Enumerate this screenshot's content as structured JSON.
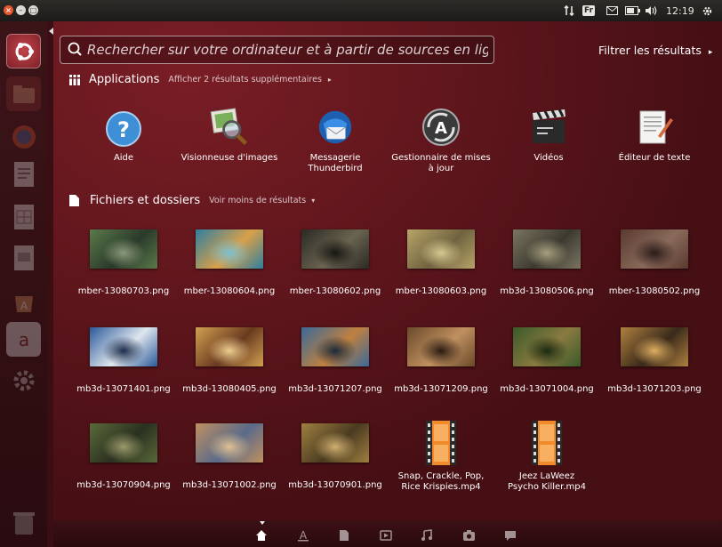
{
  "top_panel": {
    "window_close": "×",
    "keyboard_layout": "Fr",
    "clock": "12:19",
    "win_min": "–",
    "win_max": "□"
  },
  "search": {
    "placeholder": "Rechercher sur votre ordinateur et à partir de sources en ligne",
    "value": ""
  },
  "filter": {
    "label": "Filtrer les résultats"
  },
  "applications": {
    "title": "Applications",
    "more": "Afficher 2 résultats supplémentaires",
    "items": [
      {
        "label": "Aide",
        "icon": "help-icon"
      },
      {
        "label": "Visionneuse d'images",
        "icon": "image-viewer-icon"
      },
      {
        "label": "Messagerie Thunderbird",
        "icon": "thunderbird-icon"
      },
      {
        "label": "Gestionnaire de mises à jour",
        "icon": "update-manager-icon"
      },
      {
        "label": "Vidéos",
        "icon": "videos-icon"
      },
      {
        "label": "Éditeur de texte",
        "icon": "text-editor-icon"
      }
    ]
  },
  "files": {
    "title": "Fichiers et dossiers",
    "more": "Voir moins de résultats",
    "items": [
      {
        "label": "mber-13080703.png",
        "colors": [
          "#5a7a4a",
          "#2a3a2a",
          "#8a9a7a"
        ]
      },
      {
        "label": "mber-13080604.png",
        "colors": [
          "#2f7f9f",
          "#d9a04a",
          "#7ac0d0"
        ]
      },
      {
        "label": "mber-13080602.png",
        "colors": [
          "#2a2a24",
          "#6a6450",
          "#151512"
        ]
      },
      {
        "label": "mber-13080603.png",
        "colors": [
          "#b8a368",
          "#6f6340",
          "#d8c890"
        ]
      },
      {
        "label": "mb3d-13080506.png",
        "colors": [
          "#7a7460",
          "#3c3a30",
          "#a8a080"
        ]
      },
      {
        "label": "mber-13080502.png",
        "colors": [
          "#5a3a30",
          "#8a6a5a",
          "#2a1a18"
        ]
      },
      {
        "label": "mb3d-13071401.png",
        "colors": [
          "#2a5a9a",
          "#dfe6ee",
          "#1a2a4a"
        ]
      },
      {
        "label": "mb3d-13080405.png",
        "colors": [
          "#d0a050",
          "#6a3a20",
          "#f0d090"
        ]
      },
      {
        "label": "mb3d-13071207.png",
        "colors": [
          "#3a6a9a",
          "#c08040",
          "#1a2a3a"
        ]
      },
      {
        "label": "mb3d-13071209.png",
        "colors": [
          "#6a4a2a",
          "#c09060",
          "#2a1a10"
        ]
      },
      {
        "label": "mb3d-13071004.png",
        "colors": [
          "#3a5a2a",
          "#8a7a40",
          "#1a2a10"
        ]
      },
      {
        "label": "mb3d-13071203.png",
        "colors": [
          "#b08040",
          "#3a2a1a",
          "#e0b060"
        ]
      },
      {
        "label": "mb3d-13070904.png",
        "colors": [
          "#5a6a3a",
          "#2a3020",
          "#9a9a6a"
        ]
      },
      {
        "label": "mb3d-13071002.png",
        "colors": [
          "#c09060",
          "#5a6a8a",
          "#e0c090"
        ]
      },
      {
        "label": "mb3d-13070901.png",
        "colors": [
          "#a08040",
          "#4a3a20",
          "#d0b070"
        ]
      },
      {
        "label": "Snap, Crackle, Pop, Rice Krispies.mp4",
        "icon": "video-file-icon"
      },
      {
        "label": "Jeez LaWeez Psycho Killer.mp4",
        "icon": "video-file-icon"
      }
    ]
  },
  "launcher": {
    "items": [
      "dash-icon",
      "files-icon",
      "firefox-icon",
      "writer-icon",
      "calc-icon",
      "impress-icon",
      "software-center-icon",
      "amazon-icon",
      "settings-icon",
      "trash-icon"
    ]
  },
  "lenses": [
    "home-lens-icon",
    "applications-lens-icon",
    "files-lens-icon",
    "video-lens-icon",
    "music-lens-icon",
    "photo-lens-icon",
    "social-lens-icon"
  ],
  "colors": {
    "accent": "#dd4814",
    "dash_bg": "#5a1a20",
    "panel": "#2c2a27"
  }
}
